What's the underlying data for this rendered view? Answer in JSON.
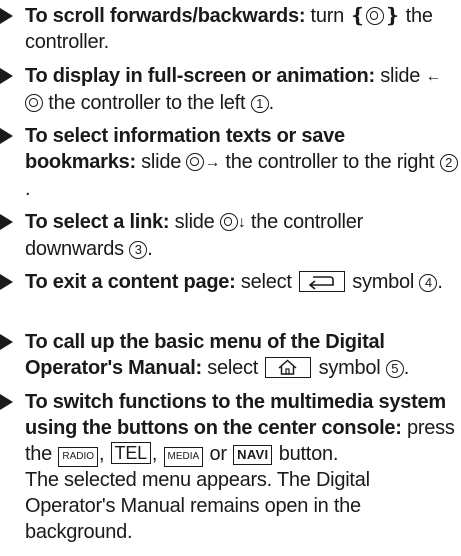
{
  "items": [
    {
      "bold": "To scroll forwards/backwards:",
      "t1": " turn ",
      "t2": " the controller."
    },
    {
      "bold": "To display in full-screen or animation:",
      "t1": " slide ",
      "t2": " the controller to the left ",
      "num": "1",
      "t3": "."
    },
    {
      "bold": "To select information texts or save bookmarks:",
      "t1": " slide ",
      "t2": " the controller to the right ",
      "num": "2",
      "t3": "."
    },
    {
      "bold": "To select a link:",
      "t1": " slide ",
      "t2": " the controller downwards ",
      "num": "3",
      "t3": "."
    },
    {
      "bold": "To exit a content page:",
      "t1": " select ",
      "t2": " symbol ",
      "num": "4",
      "t3": "."
    },
    {
      "bold": "To call up the basic menu of the Digital Operator's Manual:",
      "t1": " select ",
      "t2": " symbol ",
      "num": "5",
      "t3": "."
    },
    {
      "bold": "To switch functions to the multimedia system using the buttons on the center console:",
      "t1": " press the ",
      "btn_radio": "RADIO",
      "sep1": ", ",
      "btn_tel": "TEL",
      "sep2": ", ",
      "btn_media": "MEDIA",
      "sep3": " or ",
      "btn_navi": "NAVI",
      "t2": " button.",
      "note": "The selected menu appears. The Digital Operator's Manual remains open in the background."
    }
  ],
  "icons": {
    "controller": "controller-knob-icon",
    "arrow_left": "←",
    "arrow_right": "→",
    "arrow_down": "↓",
    "back": "back-arrow-icon",
    "home": "home-icon"
  }
}
